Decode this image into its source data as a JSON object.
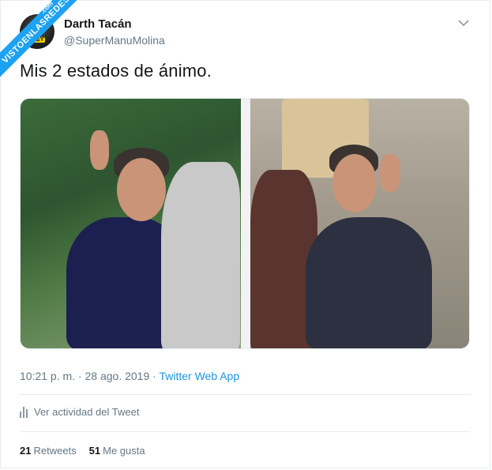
{
  "watermark": {
    "main": "VISTOENLASREDES",
    "sub": ".com"
  },
  "author": {
    "name": "Darth Tacán",
    "handle": "@SuperManuMolina",
    "avatar_badge": "NEY"
  },
  "tweet": {
    "text": "Mis 2 estados de ánimo.",
    "time": "10:21 p. m.",
    "separator": " · ",
    "date": "28 ago. 2019",
    "source": "Twitter Web App"
  },
  "activity": {
    "label": "Ver actividad del Tweet"
  },
  "stats": {
    "retweets_count": "21",
    "retweets_label": "Retweets",
    "likes_count": "51",
    "likes_label": "Me gusta"
  },
  "colors": {
    "accent": "#1da1f2",
    "link": "#1b95e0",
    "secondary_text": "#657786",
    "border": "#e6ecf0"
  },
  "icons": {
    "menu": "chevron-down-icon",
    "activity": "bar-chart-icon"
  }
}
